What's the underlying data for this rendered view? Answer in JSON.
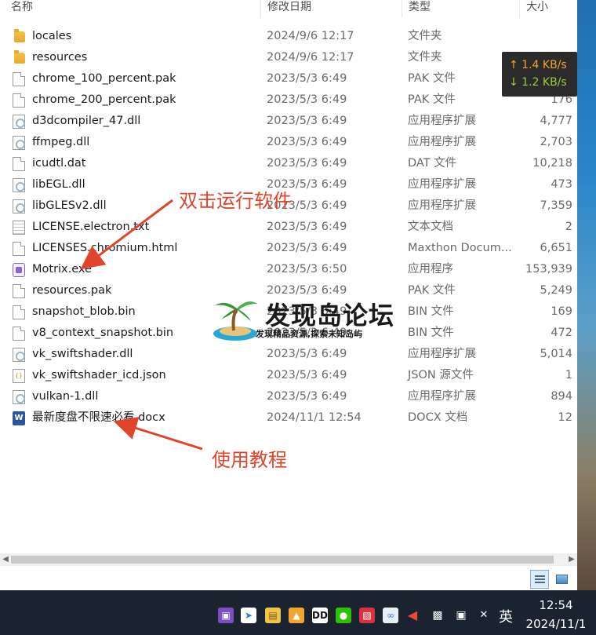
{
  "columns": {
    "name": "名称",
    "modified": "修改日期",
    "type": "类型",
    "size": "大小"
  },
  "files": [
    {
      "name": "locales",
      "date": "2024/9/6 12:17",
      "type": "文件夹",
      "size": "",
      "icon": "folder-icon"
    },
    {
      "name": "resources",
      "date": "2024/9/6 12:17",
      "type": "文件夹",
      "size": "",
      "icon": "folder-icon"
    },
    {
      "name": "chrome_100_percent.pak",
      "date": "2023/5/3 6:49",
      "type": "PAK 文件",
      "size": "",
      "icon": "file-icon"
    },
    {
      "name": "chrome_200_percent.pak",
      "date": "2023/5/3 6:49",
      "type": "PAK 文件",
      "size": "176",
      "icon": "file-icon"
    },
    {
      "name": "d3dcompiler_47.dll",
      "date": "2023/5/3 6:49",
      "type": "应用程序扩展",
      "size": "4,777",
      "icon": "dll-icon"
    },
    {
      "name": "ffmpeg.dll",
      "date": "2023/5/3 6:49",
      "type": "应用程序扩展",
      "size": "2,703",
      "icon": "dll-icon"
    },
    {
      "name": "icudtl.dat",
      "date": "2023/5/3 6:49",
      "type": "DAT 文件",
      "size": "10,218",
      "icon": "file-icon"
    },
    {
      "name": "libEGL.dll",
      "date": "2023/5/3 6:49",
      "type": "应用程序扩展",
      "size": "473",
      "icon": "dll-icon"
    },
    {
      "name": "libGLESv2.dll",
      "date": "2023/5/3 6:49",
      "type": "应用程序扩展",
      "size": "7,359",
      "icon": "dll-icon"
    },
    {
      "name": "LICENSE.electron.txt",
      "date": "2023/5/3 6:49",
      "type": "文本文档",
      "size": "2",
      "icon": "text-icon"
    },
    {
      "name": "LICENSES.chromium.html",
      "date": "2023/5/3 6:49",
      "type": "Maxthon Docum...",
      "size": "6,651",
      "icon": "file-icon"
    },
    {
      "name": "Motrix.exe",
      "date": "2023/5/3 6:50",
      "type": "应用程序",
      "size": "153,939",
      "icon": "exe-icon"
    },
    {
      "name": "resources.pak",
      "date": "2023/5/3 6:49",
      "type": "PAK 文件",
      "size": "5,249",
      "icon": "file-icon"
    },
    {
      "name": "snapshot_blob.bin",
      "date": "2023/5/3 6:49",
      "type": "BIN 文件",
      "size": "169",
      "icon": "file-icon"
    },
    {
      "name": "v8_context_snapshot.bin",
      "date": "2023/5/3 6:49",
      "type": "BIN 文件",
      "size": "472",
      "icon": "file-icon"
    },
    {
      "name": "vk_swiftshader.dll",
      "date": "2023/5/3 6:49",
      "type": "应用程序扩展",
      "size": "5,014",
      "icon": "dll-icon"
    },
    {
      "name": "vk_swiftshader_icd.json",
      "date": "2023/5/3 6:49",
      "type": "JSON 源文件",
      "size": "1",
      "icon": "json-icon"
    },
    {
      "name": "vulkan-1.dll",
      "date": "2023/5/3 6:49",
      "type": "应用程序扩展",
      "size": "894",
      "icon": "dll-icon"
    },
    {
      "name": "最新度盘不限速必看.docx",
      "date": "2024/11/1 12:54",
      "type": "DOCX 文档",
      "size": "12",
      "icon": "docx-icon"
    }
  ],
  "netspeed": {
    "upload": "↑ 1.4 KB/s",
    "download": "↓ 1.2 KB/s"
  },
  "annotations": {
    "run_hint": "双击运行软件",
    "tutorial_hint": "使用教程",
    "color": "#e0442b"
  },
  "watermark": {
    "title": "发现岛论坛",
    "subtitle": "发现精品资源,探索未知岛屿"
  },
  "taskbar": {
    "ime": "英",
    "time": "12:54",
    "date": "2024/11/1",
    "icons": [
      "motrix-icon",
      "browser-icon",
      "explorer-icon",
      "shield-icon",
      "dolby-icon",
      "wechat-icon",
      "screenshot-icon",
      "photos-icon",
      "volume-icon",
      "battery-icon",
      "network-icon",
      "mute-icon"
    ]
  }
}
